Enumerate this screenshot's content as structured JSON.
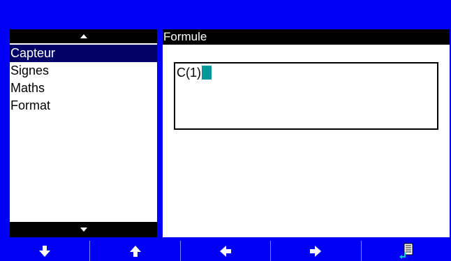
{
  "list": {
    "items": [
      {
        "label": "Capteur",
        "selected": true
      },
      {
        "label": "Signes",
        "selected": false
      },
      {
        "label": "Maths",
        "selected": false
      },
      {
        "label": "Format",
        "selected": false
      }
    ],
    "scroll_up_icon": "triangle-up-icon",
    "scroll_down_icon": "triangle-down-icon"
  },
  "formula": {
    "header": "Formule",
    "value": "C(1)",
    "cursor_color": "#009999"
  },
  "toolbar": {
    "buttons": [
      {
        "name": "arrow-down-button",
        "icon": "arrow-down-icon"
      },
      {
        "name": "arrow-up-button",
        "icon": "arrow-up-icon"
      },
      {
        "name": "arrow-left-button",
        "icon": "arrow-left-icon"
      },
      {
        "name": "arrow-right-button",
        "icon": "arrow-right-icon"
      },
      {
        "name": "insert-button",
        "icon": "insert-document-icon"
      }
    ]
  },
  "colors": {
    "background": "#0000f4",
    "selection": "#000066",
    "header": "#000000"
  }
}
